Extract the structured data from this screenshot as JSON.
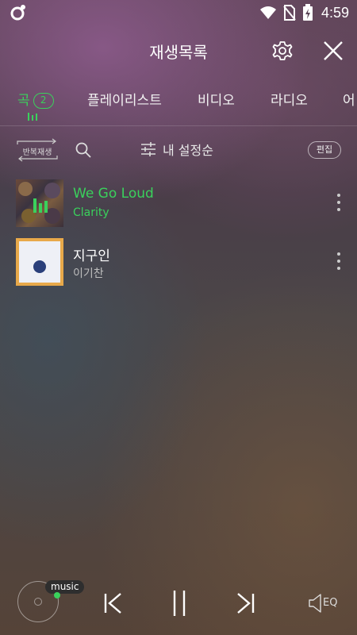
{
  "status_bar": {
    "time": "4:59"
  },
  "header": {
    "title": "재생목록"
  },
  "tabs": [
    {
      "label": "곡",
      "badge": "2",
      "active": true
    },
    {
      "label": "플레이리스트",
      "active": false
    },
    {
      "label": "비디오",
      "active": false
    },
    {
      "label": "라디오",
      "active": false
    },
    {
      "label": "어",
      "active": false
    }
  ],
  "toolbar": {
    "repeat_label": "반복재생",
    "sort_label": "내 설정순",
    "edit_label": "편집"
  },
  "songs": [
    {
      "title": "We Go Loud",
      "artist": "Clarity",
      "playing": true
    },
    {
      "title": "지구인",
      "artist": "이기찬",
      "playing": false
    }
  ],
  "player": {
    "badge": "music",
    "eq_label": "EQ"
  },
  "colors": {
    "accent": "#3ad15c",
    "badge_bg": "#2e2e2e"
  }
}
